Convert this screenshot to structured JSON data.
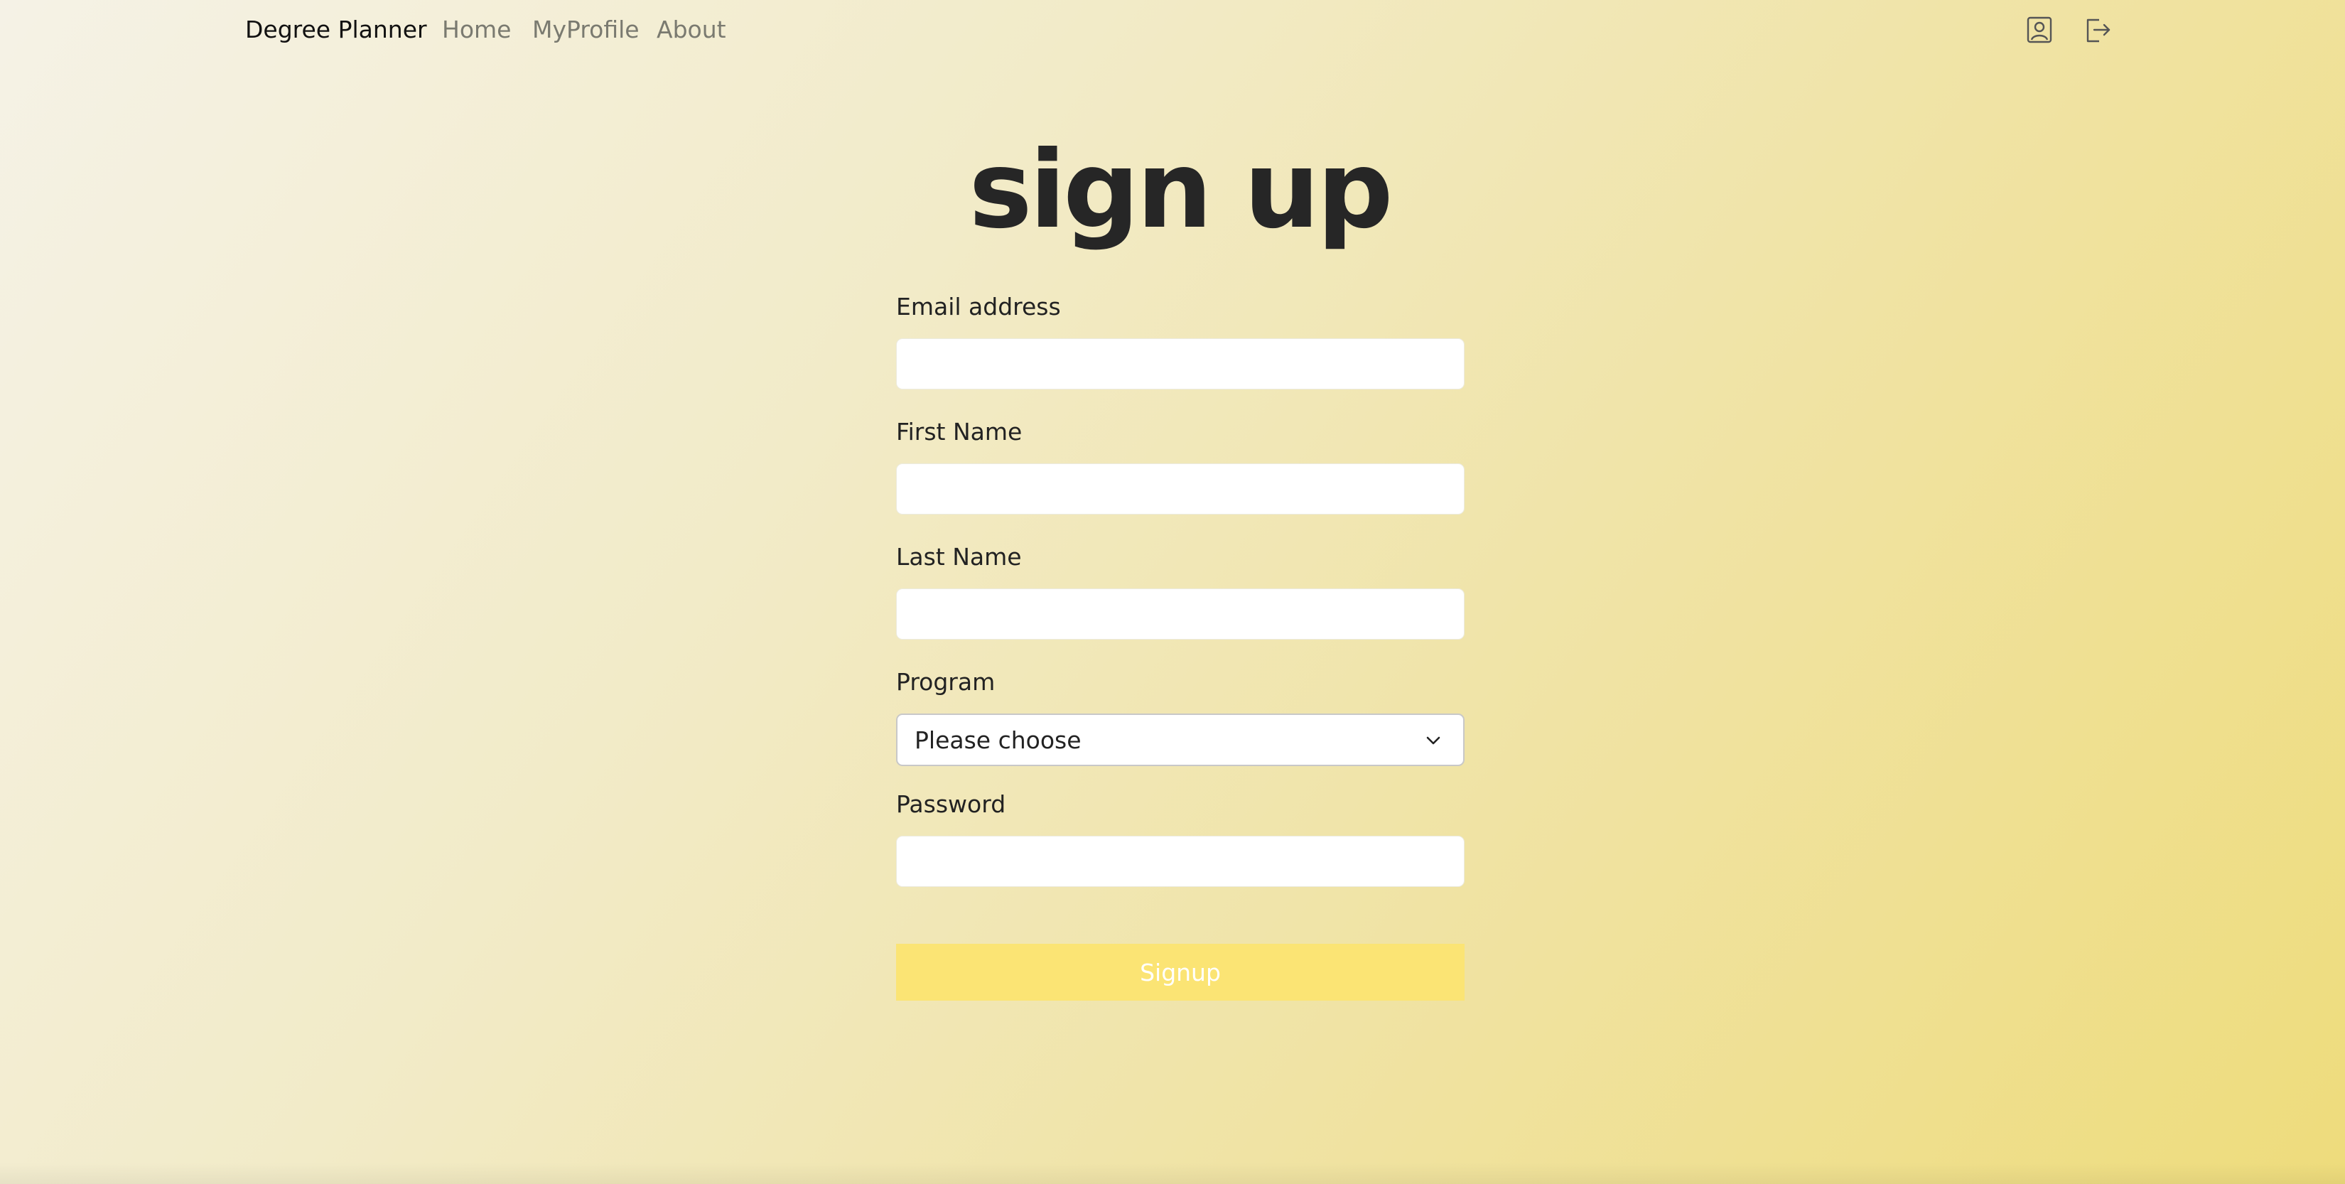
{
  "navbar": {
    "brand": "Degree Planner",
    "links": [
      {
        "label": "Home"
      },
      {
        "label": "MyProfile"
      },
      {
        "label": "About"
      }
    ],
    "icons": [
      "user-profile-icon",
      "logout-icon"
    ]
  },
  "page": {
    "title": "sign up"
  },
  "form": {
    "email_label": "Email address",
    "email_value": "",
    "first_name_label": "First Name",
    "first_name_value": "",
    "last_name_label": "Last Name",
    "last_name_value": "",
    "program_label": "Program",
    "program_selected": "Please choose",
    "password_label": "Password",
    "password_value": "",
    "submit_label": "Signup"
  },
  "colors": {
    "button_background": "#fbe474",
    "button_text": "#ffffff",
    "background_start": "#f5f2e6",
    "background_end": "#eedc7c"
  }
}
